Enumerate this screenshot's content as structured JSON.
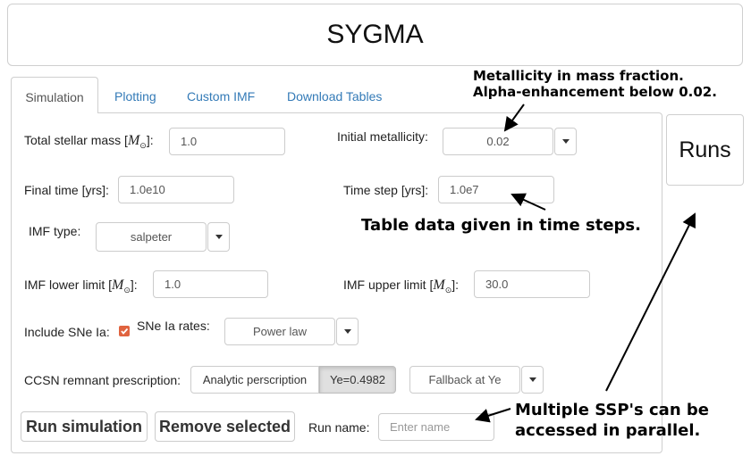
{
  "app": {
    "title": "SYGMA",
    "runs_label": "Runs"
  },
  "tabs": [
    {
      "label": "Simulation",
      "active": true
    },
    {
      "label": "Plotting",
      "active": false
    },
    {
      "label": "Custom IMF",
      "active": false
    },
    {
      "label": "Download Tables",
      "active": false
    }
  ],
  "form": {
    "total_mass": {
      "label_pre": "Total stellar mass [",
      "unit": "M",
      "label_post": "]:",
      "value": "1.0"
    },
    "metallicity": {
      "label": "Initial metallicity:",
      "value": "0.02"
    },
    "final_time": {
      "label": "Final time [yrs]:",
      "value": "1.0e10"
    },
    "time_step": {
      "label": "Time step [yrs]:",
      "value": "1.0e7"
    },
    "imf_type": {
      "label": "IMF type:",
      "value": "salpeter"
    },
    "imf_lower": {
      "label_pre": "IMF lower limit [",
      "unit": "M",
      "label_post": "]:",
      "value": "1.0"
    },
    "imf_upper": {
      "label_pre": "IMF upper limit [",
      "unit": "M",
      "label_post": "]:",
      "value": "30.0"
    },
    "snia": {
      "label": "Include SNe Ia:",
      "checked": true,
      "rates_label": "SNe Ia rates:",
      "rates_value": "Power law"
    },
    "ccsn": {
      "label": "CCSN remnant prescription:",
      "option_1": "Analytic perscription",
      "option_2": "Ye=0.4982",
      "fallback_value": "Fallback at Ye"
    },
    "run_simulation": "Run simulation",
    "remove_selected": "Remove selected",
    "run_name": {
      "label": "Run name:",
      "placeholder": "Enter name"
    }
  },
  "annotations": {
    "metallicity_line1": "Metallicity in mass fraction.",
    "metallicity_line2": "Alpha-enhancement below 0.02.",
    "table_data": "Table data given in time steps.",
    "multiple_line1": "Multiple SSP's can be",
    "multiple_line2": "accessed in parallel."
  },
  "colors": {
    "tab_link": "#337ab7",
    "checkbox": "#e0633f",
    "border": "#cccccc"
  }
}
